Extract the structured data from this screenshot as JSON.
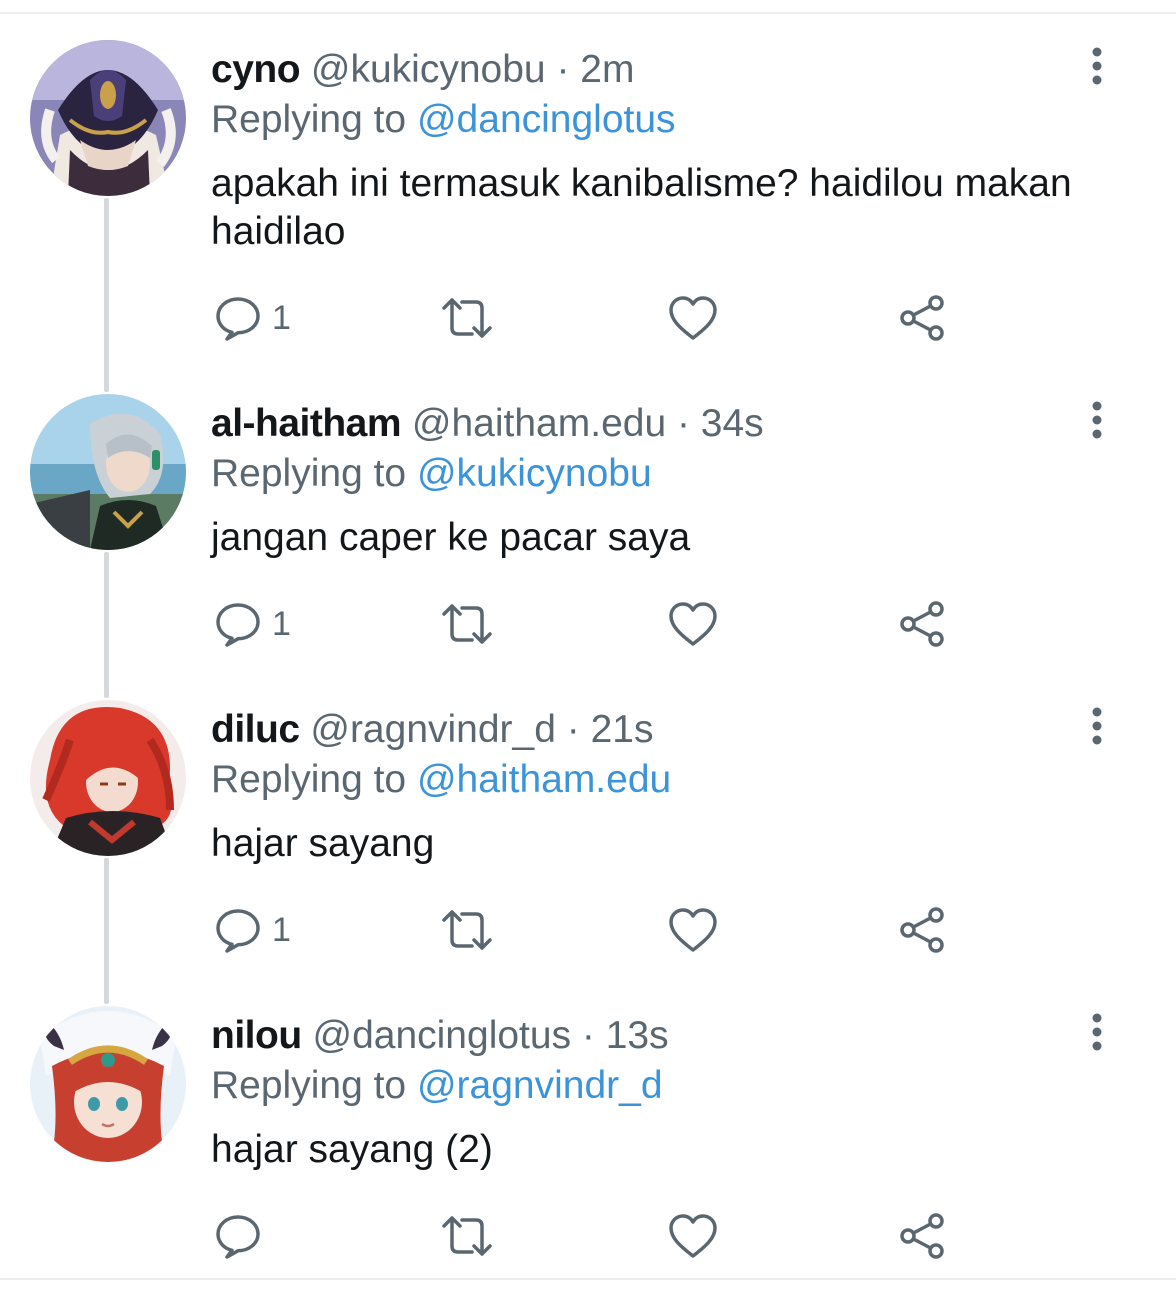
{
  "colors": {
    "text": "#14171a",
    "secondary": "#5b6770",
    "link": "#3b94d9",
    "icon": "#5b6770",
    "thread_line": "#d5d9dd"
  },
  "reply_prefix": "Replying to",
  "icons": {
    "reply": "reply-icon",
    "retweet": "retweet-icon",
    "like": "heart-icon",
    "share": "share-icon",
    "more": "more-vertical-icon"
  },
  "tweets": [
    {
      "name": "cyno",
      "handle": "@kukicynobu",
      "time": "· 2m",
      "reply_to": "@dancinglotus",
      "text": "apakah ini termasuk kanibalisme? haidilou makan haidilao",
      "reply_count": "1"
    },
    {
      "name": "al-haitham",
      "handle": "@haitham.edu",
      "time": "· 34s",
      "reply_to": "@kukicynobu",
      "text": "jangan caper ke pacar saya",
      "reply_count": "1"
    },
    {
      "name": "diluc",
      "handle": "@ragnvindr_d",
      "time": "· 21s",
      "reply_to": "@haitham.edu",
      "text": "hajar sayang",
      "reply_count": "1"
    },
    {
      "name": "nilou",
      "handle": "@dancinglotus",
      "time": "· 13s",
      "reply_to": "@ragnvindr_d",
      "text": "hajar sayang (2)",
      "reply_count": ""
    }
  ]
}
